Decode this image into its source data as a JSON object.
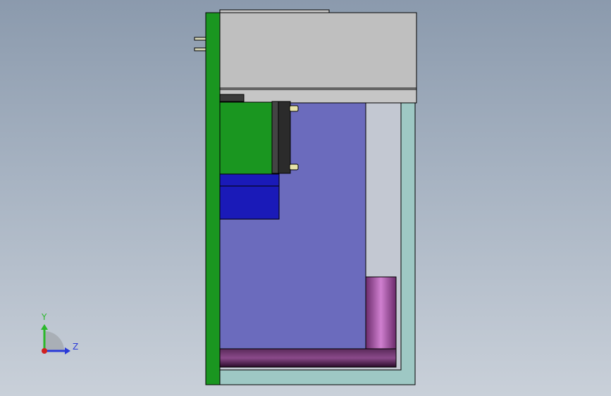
{
  "viewport": {
    "background_top": "#8b9aad",
    "background_bottom": "#c9d0d9"
  },
  "model": {
    "colors": {
      "pcb_green": "#1a9620",
      "enclosure_gray": "#bebebe",
      "enclosure_lower_gray": "#c6c6c6",
      "housing_teal": "#9ec8c4",
      "housing_inner": "#c3c8d2",
      "slate_block": "#6b6bbd",
      "blue_block": "#1a1ab8",
      "connector_dark": "#2b2b2b",
      "magenta_base": "#c070c0",
      "outline": "#000000"
    },
    "parts": [
      "pcb-board",
      "enclosure-top",
      "enclosure-bottom-strip",
      "housing-frame",
      "slate-block",
      "green-module",
      "blue-block",
      "black-connector",
      "magenta-base",
      "pin-tabs",
      "screw-terminals"
    ]
  },
  "triad": {
    "y_label": "Y",
    "z_label": "Z",
    "y_color": "#2ab82a",
    "z_color": "#2a3ad8",
    "x_color": "#d02020"
  }
}
